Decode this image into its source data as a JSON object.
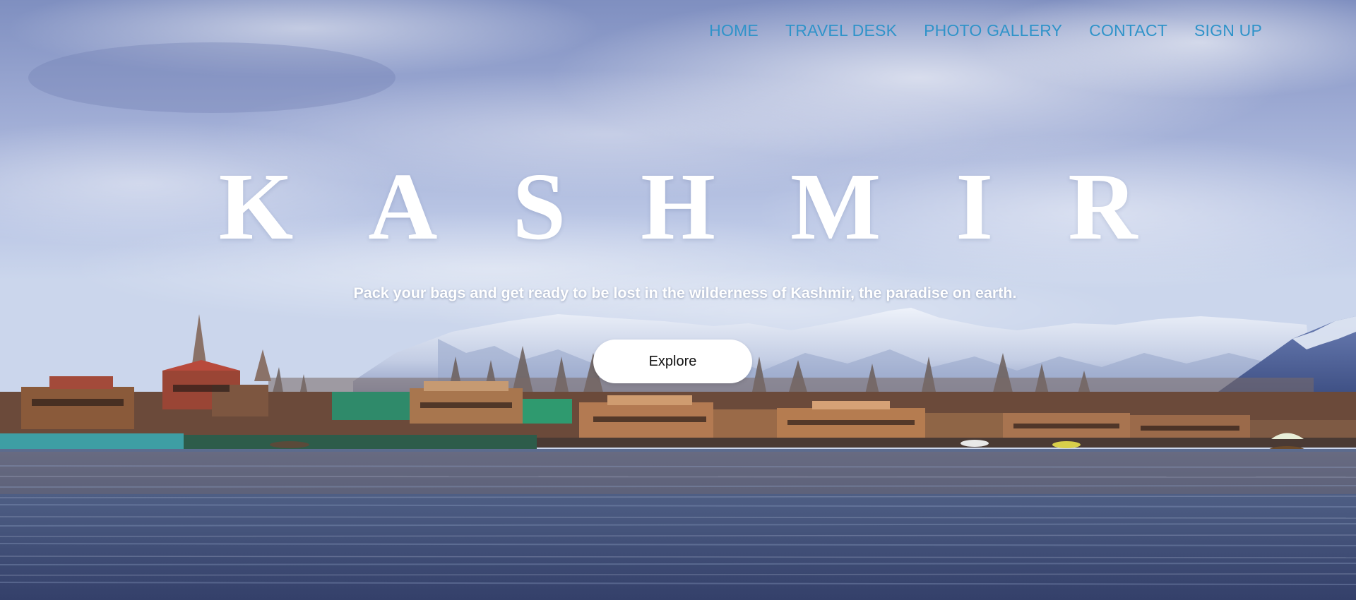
{
  "nav": {
    "items": [
      {
        "label": "HOME"
      },
      {
        "label": "TRAVEL DESK"
      },
      {
        "label": "PHOTO GALLERY"
      },
      {
        "label": "CONTACT"
      },
      {
        "label": "SIGN UP"
      }
    ]
  },
  "hero": {
    "title": "KASHMIR",
    "tagline": "Pack your bags and get ready to be lost in the wilderness of Kashmir, the paradise on earth.",
    "explore_label": "Explore"
  },
  "theme": {
    "nav_color": "#2f93c9",
    "title_color": "#ffffff",
    "button_bg": "#ffffff"
  }
}
